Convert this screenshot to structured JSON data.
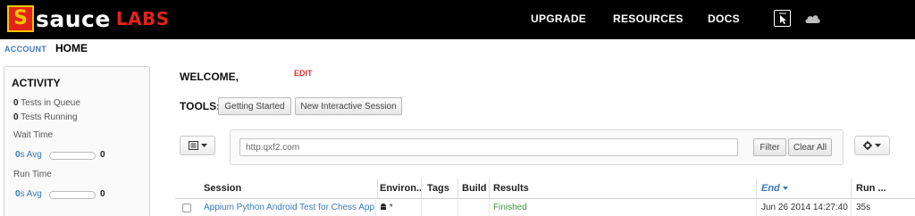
{
  "header": {
    "logo_mark": "S",
    "logo_sauce": "sauce",
    "logo_labs": "LABS",
    "nav": [
      "UPGRADE",
      "RESOURCES",
      "DOCS"
    ],
    "icons": [
      "interactive-tool-icon",
      "cloud-icon"
    ]
  },
  "breadcrumb": {
    "account": "ACCOUNT",
    "home": "HOME"
  },
  "activity": {
    "title": "ACTIVITY",
    "queue_count": "0",
    "queue_label": "Tests in Queue",
    "running_count": "0",
    "running_label": "Tests Running",
    "wait_time_label": "Wait Time",
    "wait_avg_value": "0",
    "wait_avg_unit": "s Avg",
    "wait_bar_value": "0",
    "wait_bar_fraction": 0,
    "run_time_label": "Run Time",
    "run_avg_value": "0",
    "run_avg_unit": "s Avg",
    "run_bar_value": "0",
    "run_bar_fraction": 0
  },
  "main": {
    "welcome": "WELCOME,",
    "edit": "EDIT",
    "tools_label": "TOOLS:",
    "tools": [
      "Getting Started",
      "New Interactive Session"
    ]
  },
  "filter": {
    "value": "http:qxf2.com",
    "filter_button": "Filter",
    "clear_button": "Clear All"
  },
  "table": {
    "columns": [
      "Session",
      "Environ...",
      "Tags",
      "Build",
      "Results",
      "End",
      "Run ..."
    ],
    "sorted_column": "End",
    "rows": [
      {
        "session": "Appium Python Android Test for Chess App",
        "environment": "*",
        "tags": "",
        "build": "",
        "results": "Finished",
        "end": "Jun 26 2014 14:27:40",
        "run": "35s"
      }
    ]
  },
  "colors": {
    "topbar": "#000000",
    "brand_red": "#e2231a",
    "brand_yellow": "#f5c400",
    "link_blue": "#3a7ab8",
    "success_green": "#3a9a3a"
  }
}
